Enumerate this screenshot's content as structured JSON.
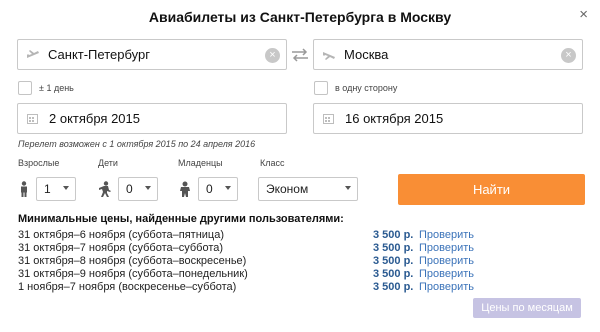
{
  "dialog": {
    "title": "Авиабилеты из Санкт-Петербурга в Москву",
    "close_icon": "×"
  },
  "from": {
    "value": "Санкт-Петербург",
    "icon": "plane-takeoff-icon"
  },
  "to": {
    "value": "Москва",
    "icon": "plane-landing-icon"
  },
  "swap": {
    "icon": "swap-arrows-icon"
  },
  "options": {
    "flex_days_label": "± 1 день",
    "one_way_label": "в одну сторону"
  },
  "dates": {
    "depart": "2 октября 2015",
    "return": "16 октября 2015",
    "icon": "calendar-icon"
  },
  "note": "Перелет возможен с 1 октября 2015 по 24 апреля 2016",
  "passengers": {
    "adults_label": "Взрослые",
    "adults_value": "1",
    "children_label": "Дети",
    "children_value": "0",
    "infants_label": "Младенцы",
    "infants_value": "0",
    "class_label": "Класс",
    "class_value": "Эконом"
  },
  "search_button": "Найти",
  "min_prices": {
    "title": "Минимальные цены, найденные другими пользователями:",
    "rows": [
      {
        "dates": "31 октября–6 ноября (суббота–пятница)",
        "price": "3 500 р.",
        "check": "Проверить"
      },
      {
        "dates": "31 октября–7 ноября (суббота–суббота)",
        "price": "3 500 р.",
        "check": "Проверить"
      },
      {
        "dates": "31 октября–8 ноября (суббота–воскресенье)",
        "price": "3 500 р.",
        "check": "Проверить"
      },
      {
        "dates": "31 октября–9 ноября (суббота–понедельник)",
        "price": "3 500 р.",
        "check": "Проверить"
      },
      {
        "dates": "1 ноября–7 ноября (воскресенье–суббота)",
        "price": "3 500 р.",
        "check": "Проверить"
      }
    ]
  },
  "months_button": "Цены по месяцам",
  "colors": {
    "accent": "#f98e35",
    "link": "#3b73b9",
    "months_button": "#c6c3e3"
  }
}
